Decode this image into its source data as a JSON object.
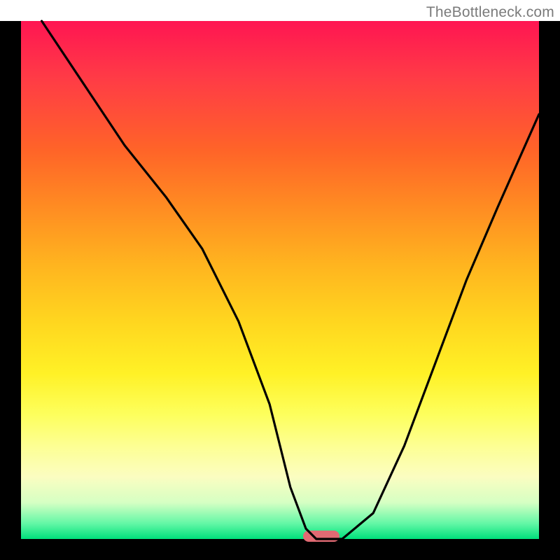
{
  "watermark": "TheBottleneck.com",
  "chart_data": {
    "type": "line",
    "title": "",
    "xlabel": "",
    "ylabel": "",
    "xlim": [
      0,
      100
    ],
    "ylim": [
      0,
      100
    ],
    "series": [
      {
        "name": "curve",
        "x": [
          4,
          12,
          20,
          28,
          35,
          42,
          48,
          52,
          55,
          57,
          62,
          68,
          74,
          80,
          86,
          92,
          100
        ],
        "values": [
          100,
          88,
          76,
          66,
          56,
          42,
          26,
          10,
          2,
          0,
          0,
          5,
          18,
          34,
          50,
          64,
          82
        ]
      }
    ],
    "marker": {
      "x": 58,
      "y": 0,
      "width_pct": 7
    },
    "gradient_stops": [
      {
        "pct": 0,
        "color": "#ff1552"
      },
      {
        "pct": 25,
        "color": "#ff6428"
      },
      {
        "pct": 50,
        "color": "#ffc81f"
      },
      {
        "pct": 75,
        "color": "#fdff5d"
      },
      {
        "pct": 100,
        "color": "#00e07b"
      }
    ]
  }
}
